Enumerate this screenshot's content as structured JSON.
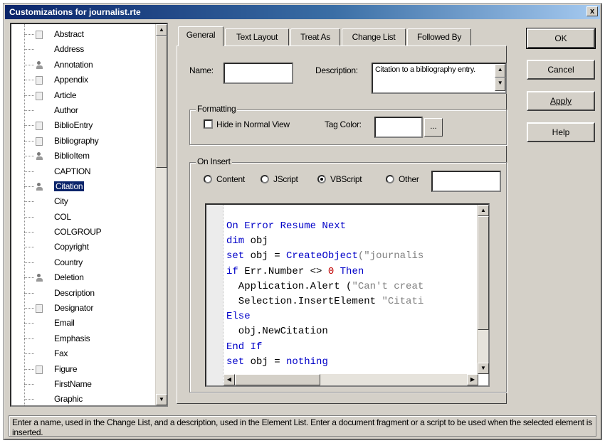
{
  "window": {
    "title": "Customizations for journalist.rte",
    "close_label": "x"
  },
  "tree": {
    "items": [
      {
        "label": "Abstract",
        "icon": "page-icon"
      },
      {
        "label": "Address",
        "icon": "none"
      },
      {
        "label": "Annotation",
        "icon": "person-icon"
      },
      {
        "label": "Appendix",
        "icon": "page-icon"
      },
      {
        "label": "Article",
        "icon": "page-icon"
      },
      {
        "label": "Author",
        "icon": "none"
      },
      {
        "label": "BiblioEntry",
        "icon": "page-icon"
      },
      {
        "label": "Bibliography",
        "icon": "page-icon"
      },
      {
        "label": "BiblioItem",
        "icon": "person-icon"
      },
      {
        "label": "CAPTION",
        "icon": "none"
      },
      {
        "label": "Citation",
        "icon": "person-icon",
        "selected": true
      },
      {
        "label": "City",
        "icon": "none"
      },
      {
        "label": "COL",
        "icon": "none"
      },
      {
        "label": "COLGROUP",
        "icon": "none"
      },
      {
        "label": "Copyright",
        "icon": "none"
      },
      {
        "label": "Country",
        "icon": "none"
      },
      {
        "label": "Deletion",
        "icon": "person-icon"
      },
      {
        "label": "Description",
        "icon": "none"
      },
      {
        "label": "Designator",
        "icon": "page-icon"
      },
      {
        "label": "Email",
        "icon": "none"
      },
      {
        "label": "Emphasis",
        "icon": "none"
      },
      {
        "label": "Fax",
        "icon": "none"
      },
      {
        "label": "Figure",
        "icon": "page-icon"
      },
      {
        "label": "FirstName",
        "icon": "none"
      },
      {
        "label": "Graphic",
        "icon": "none"
      }
    ]
  },
  "tabs": [
    {
      "label": "General",
      "active": true
    },
    {
      "label": "Text Layout",
      "active": false
    },
    {
      "label": "Treat As",
      "active": false
    },
    {
      "label": "Change List",
      "active": false
    },
    {
      "label": "Followed By",
      "active": false
    }
  ],
  "general": {
    "name_label": "Name:",
    "name_value": "",
    "description_label": "Description:",
    "description_value": "Citation to a bibliography entry.",
    "formatting_title": "Formatting",
    "hide_label": "Hide in Normal View",
    "hide_checked": false,
    "tag_color_label": "Tag Color:",
    "tag_color_value": "",
    "color_button_label": "...",
    "on_insert_title": "On Insert",
    "radio_options": [
      {
        "label": "Content",
        "checked": false
      },
      {
        "label": "JScript",
        "checked": false
      },
      {
        "label": "VBScript",
        "checked": true
      },
      {
        "label": "Other",
        "checked": false
      }
    ],
    "other_value": ""
  },
  "code": {
    "lines": [
      [
        {
          "t": "On Error Resume Next",
          "c": "kw"
        }
      ],
      [
        {
          "t": "dim",
          "c": "kw"
        },
        {
          "t": " obj",
          "c": ""
        }
      ],
      [
        {
          "t": "set",
          "c": "kw"
        },
        {
          "t": " obj = ",
          "c": ""
        },
        {
          "t": "CreateObject",
          "c": "kw"
        },
        {
          "t": "(\"journalis",
          "c": "str"
        }
      ],
      [
        {
          "t": "if",
          "c": "kw"
        },
        {
          "t": " Err.Number <> ",
          "c": ""
        },
        {
          "t": "0",
          "c": "num"
        },
        {
          "t": " ",
          "c": ""
        },
        {
          "t": "Then",
          "c": "kw"
        }
      ],
      [
        {
          "t": "  Application.Alert (",
          "c": ""
        },
        {
          "t": "\"Can't creat",
          "c": "str"
        }
      ],
      [
        {
          "t": "  Selection.InsertElement ",
          "c": ""
        },
        {
          "t": "\"Citati",
          "c": "str"
        }
      ],
      [
        {
          "t": "Else",
          "c": "kw"
        }
      ],
      [
        {
          "t": "  obj.NewCitation",
          "c": ""
        }
      ],
      [
        {
          "t": "End If",
          "c": "kw"
        }
      ],
      [
        {
          "t": "set",
          "c": "kw"
        },
        {
          "t": " obj = ",
          "c": ""
        },
        {
          "t": "nothing",
          "c": "kw"
        }
      ]
    ]
  },
  "buttons": {
    "ok": "OK",
    "cancel": "Cancel",
    "apply": "Apply",
    "help": "Help"
  },
  "status": {
    "text": "Enter a name, used in the Change List, and a description, used in the Element List. Enter a document fragment or a script to be used when the selected element is inserted."
  }
}
